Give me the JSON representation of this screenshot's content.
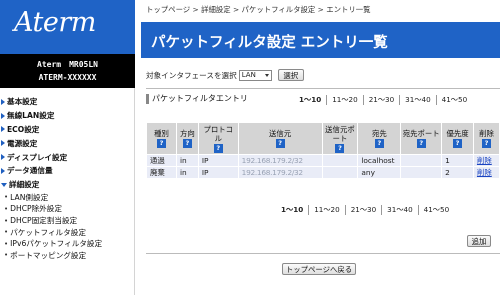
{
  "sidebar": {
    "logo": "Aterm",
    "model_line1": "Aterm　MR05LN",
    "model_line2": "ATERM-XXXXXX",
    "menu": [
      {
        "label": "基本設定"
      },
      {
        "label": "無線LAN設定"
      },
      {
        "label": "ECO設定"
      },
      {
        "label": "電源設定"
      },
      {
        "label": "ディスプレイ設定"
      },
      {
        "label": "データ通信量"
      },
      {
        "label": "詳細設定"
      }
    ],
    "sub_menu": [
      {
        "label": "LAN側設定"
      },
      {
        "label": "DHCP除外設定"
      },
      {
        "label": "DHCP固定割当設定"
      },
      {
        "label": "パケットフィルタ設定"
      },
      {
        "label": "IPv6パケットフィルタ設定"
      },
      {
        "label": "ポートマッピング設定"
      }
    ]
  },
  "breadcrumb": "トップページ > 詳細設定 > パケットフィルタ設定 > エントリ一覧",
  "page_title": "パケットフィルタ設定 エントリ一覧",
  "interface_select": {
    "label": "対象インタフェースを選択",
    "value": "LAN",
    "button": "選択"
  },
  "panel": {
    "title": "パケットフィルタエントリ",
    "pager": [
      "1～10",
      "11～20",
      "21～30",
      "31～40",
      "41～50"
    ],
    "pager_active_index": 0
  },
  "table": {
    "headers": [
      "種別",
      "方向",
      "プロトコル",
      "送信元",
      "送信元ポート",
      "宛先",
      "宛先ポート",
      "優先度",
      "削除"
    ],
    "help_glyph": "?",
    "rows": [
      {
        "type": "通過",
        "direction": "in",
        "protocol": "IP",
        "source": "192.168.179.2/32",
        "source_port": "",
        "dest": "localhost",
        "dest_port": "",
        "priority": "1",
        "delete": "削除"
      },
      {
        "type": "廃棄",
        "direction": "in",
        "protocol": "IP",
        "source": "192.168.179.2/32",
        "source_port": "",
        "dest": "any",
        "dest_port": "",
        "priority": "2",
        "delete": "削除"
      }
    ]
  },
  "buttons": {
    "add": "追加",
    "back_to_top": "トップページへ戻る"
  },
  "colors": {
    "brand_blue": "#1f63c6",
    "header_gray": "#d4d4d4",
    "row_tint": "#e9ecf7",
    "link": "#1a44c2"
  }
}
